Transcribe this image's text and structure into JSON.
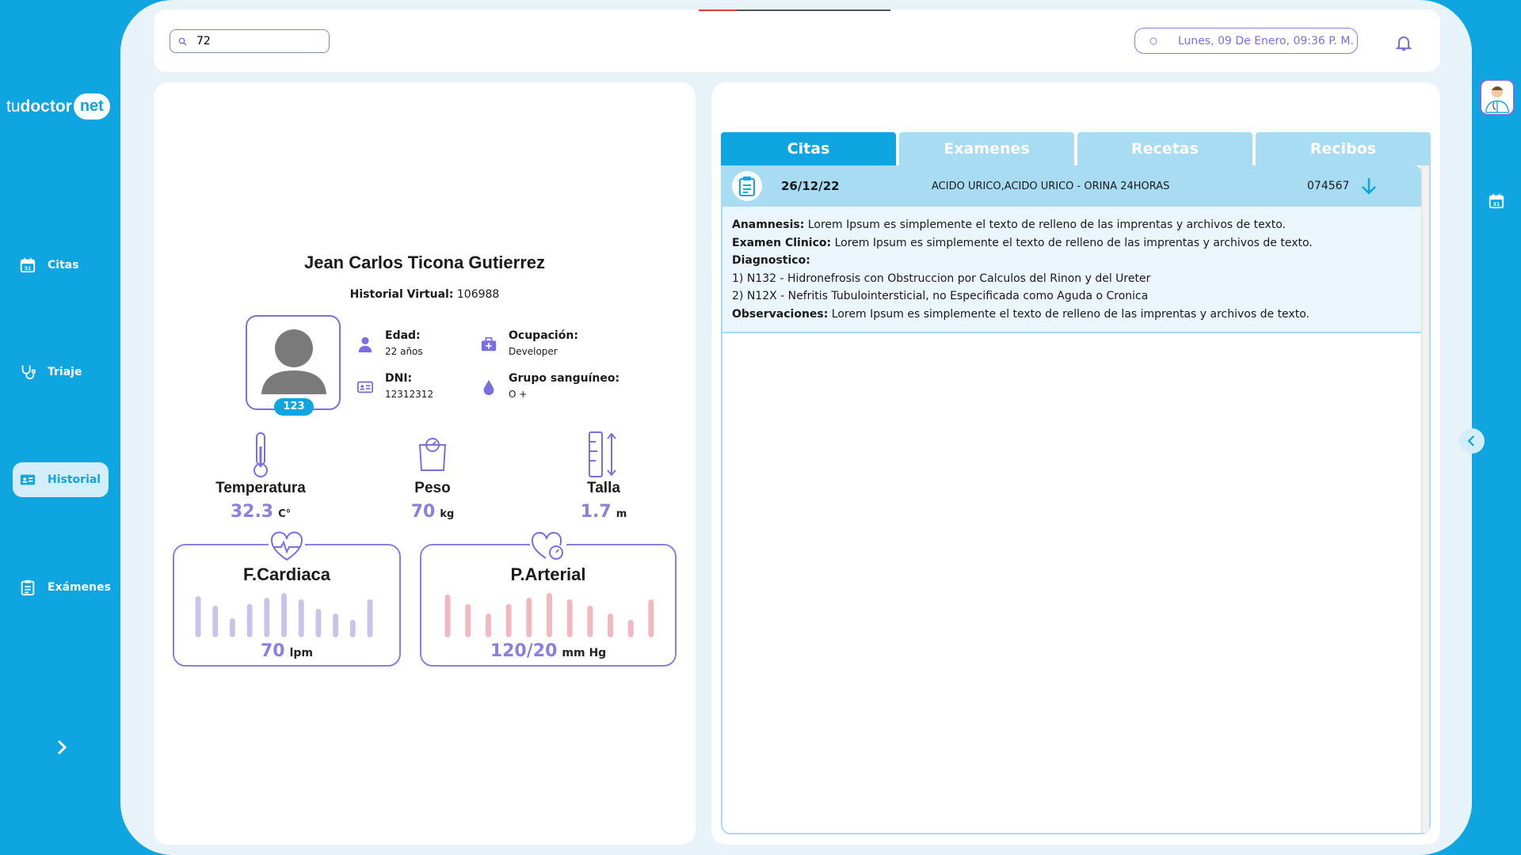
{
  "brand": {
    "tu": "tu",
    "doctor": "doctor",
    "net": "net"
  },
  "nav": {
    "items": [
      {
        "label": "Citas",
        "icon": "calendar-icon"
      },
      {
        "label": "Triaje",
        "icon": "stethoscope-icon"
      },
      {
        "label": "Historial",
        "icon": "id-card-icon",
        "active": true
      },
      {
        "label": "Exámenes",
        "icon": "clipboard-icon"
      }
    ]
  },
  "topbar": {
    "search_value": "72",
    "datetime": "Lunes, 09 De Enero, 09:36 P. M."
  },
  "patient": {
    "name": "Jean Carlos Ticona Gutierrez",
    "history_label": "Historial Virtual:",
    "history_number": "106988",
    "badge": "123",
    "age_label": "Edad:",
    "age_value": "22 años",
    "occupation_label": "Ocupación:",
    "occupation_value": "Developer",
    "dni_label": "DNI:",
    "dni_value": "12312312",
    "blood_label": "Grupo sanguíneo:",
    "blood_value": "O +"
  },
  "vitals": {
    "temperature": {
      "label": "Temperatura",
      "value": "32.3",
      "unit": "C°"
    },
    "weight": {
      "label": "Peso",
      "value": "70",
      "unit": "kg"
    },
    "height": {
      "label": "Talla",
      "value": "1.7",
      "unit": "m"
    },
    "heart_rate": {
      "label": "F.Cardiaca",
      "value": "70",
      "unit": "lpm"
    },
    "blood_pressure": {
      "label": "P.Arterial",
      "value": "120/20",
      "unit": "mm Hg"
    }
  },
  "colors": {
    "primary": "#0ea5e0",
    "accent": "#8b7fdc",
    "heart_bars": "#c9c3e8",
    "pressure_bars": "#f2b8c0"
  },
  "tabs": [
    {
      "label": "Citas",
      "active": true
    },
    {
      "label": "Examenes"
    },
    {
      "label": "Recetas"
    },
    {
      "label": "Recibos"
    }
  ],
  "record": {
    "date": "26/12/22",
    "description": "ACIDO URICO,ACIDO URICO - ORINA 24HORAS",
    "code": "074567",
    "anamnesis_label": "Anamnesis:",
    "anamnesis_text": "Lorem Ipsum es simplemente el texto de relleno de las imprentas y archivos de texto.",
    "exam_label": "Examen Clinico:",
    "exam_text": "Lorem Ipsum es simplemente el texto de relleno de las imprentas y archivos de texto.",
    "diagnosis_label": "Diagnostico:",
    "diagnosis_1": "1) N132 - Hidronefrosis con Obstruccion por Calculos del Rinon y del Ureter",
    "diagnosis_2": "2) N12X - Nefritis Tubulointersticial, no Especificada como Aguda o Cronica",
    "observations_label": "Observaciones:",
    "observations_text": "Lorem Ipsum es simplemente el texto de relleno de las imprentas y archivos de texto."
  }
}
